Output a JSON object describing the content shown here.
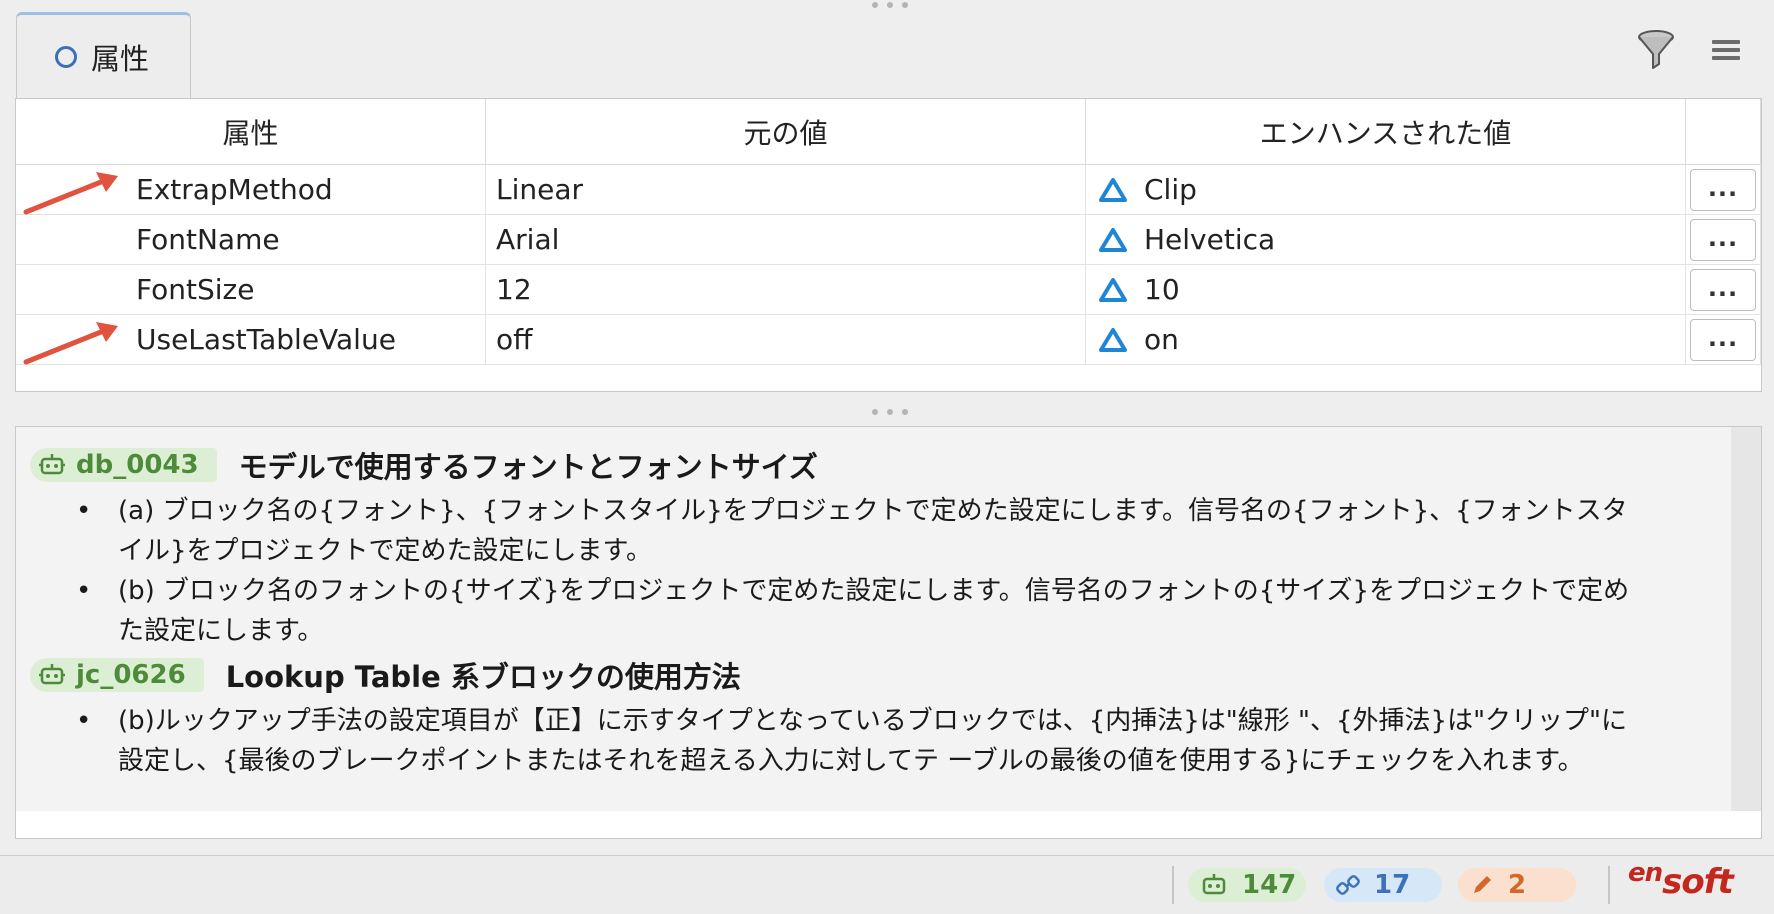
{
  "tab": {
    "label": "属性"
  },
  "table": {
    "headers": [
      "属性",
      "元の値",
      "エンハンスされた値"
    ],
    "rows": [
      {
        "name": "ExtrapMethod",
        "original": "Linear",
        "enhanced": "Clip",
        "button": "..."
      },
      {
        "name": "FontName",
        "original": "Arial",
        "enhanced": "Helvetica",
        "button": "..."
      },
      {
        "name": "FontSize",
        "original": "12",
        "enhanced": "10",
        "button": "..."
      },
      {
        "name": "UseLastTableValue",
        "original": "off",
        "enhanced": "on",
        "button": "..."
      }
    ]
  },
  "guidelines": [
    {
      "id": "db_0043",
      "title": "モデルで使用するフォントとフォントサイズ",
      "bullets": [
        "(a) ブロック名の{フォント}、{フォントスタイル}をプロジェクトで定めた設定にします。信号名の{フォント}、{フォントスタイル}をプロジェクトで定めた設定にします。",
        "(b) ブロック名のフォントの{サイズ}をプロジェクトで定めた設定にします。信号名のフォントの{サイズ}をプロジェクトで定めた設定にします。"
      ]
    },
    {
      "id": "jc_0626",
      "title": "Lookup Table 系ブロックの使用方法",
      "bullets": [
        "(b)ルックアップ手法の設定項目が【正】に示すタイプとなっているブロックでは、{内挿法}は\"線形 \"、{外挿法}は\"クリップ\"に設定し、{最後のブレークポイントまたはそれを超える入力に対してテ ーブルの最後の値を使用する}にチェックを入れます。"
      ]
    }
  ],
  "status": {
    "rules_count": "147",
    "links_count": "17",
    "edits_count": "2"
  },
  "logo": {
    "small": "en",
    "big": "soft"
  },
  "colors": {
    "accent_blue": "#1f86d6",
    "badge_green": "#4d8b3a",
    "arrow_red": "#e0533f",
    "logo_red": "#c3271d"
  }
}
